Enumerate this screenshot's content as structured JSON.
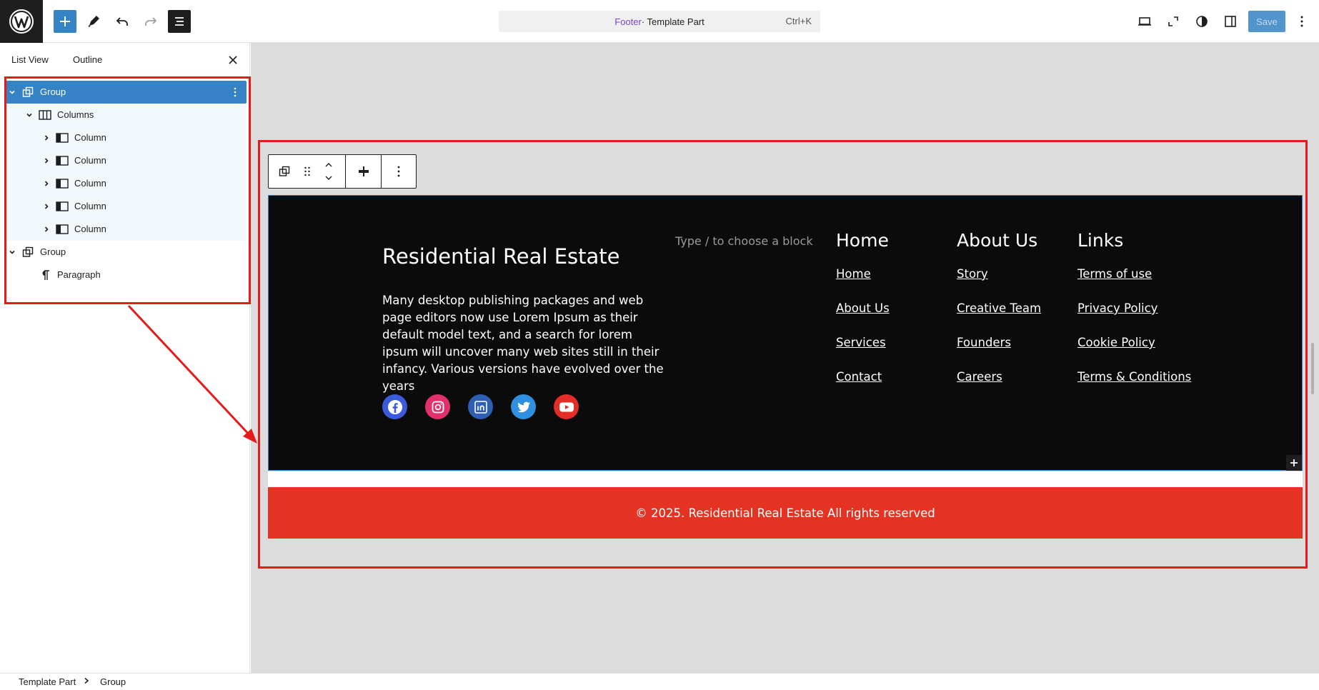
{
  "topbar": {
    "doc_type": "Footer",
    "doc_kind": " · Template Part",
    "shortcut": "Ctrl+K",
    "save_label": "Save"
  },
  "left_panel": {
    "tabs": [
      "List View",
      "Outline"
    ],
    "tree": [
      {
        "label": "Group",
        "icon": "group-icon",
        "depth": 0,
        "expanded": true,
        "selected": true
      },
      {
        "label": "Columns",
        "icon": "columns-icon",
        "depth": 1,
        "expanded": true
      },
      {
        "label": "Column",
        "icon": "column-icon",
        "depth": 2,
        "expanded": false
      },
      {
        "label": "Column",
        "icon": "column-icon",
        "depth": 2,
        "expanded": false
      },
      {
        "label": "Column",
        "icon": "column-icon",
        "depth": 2,
        "expanded": false
      },
      {
        "label": "Column",
        "icon": "column-icon",
        "depth": 2,
        "expanded": false
      },
      {
        "label": "Column",
        "icon": "column-icon",
        "depth": 2,
        "expanded": false
      },
      {
        "label": "Group",
        "icon": "group-icon",
        "depth": 0,
        "expanded": true
      },
      {
        "label": "Paragraph",
        "icon": "paragraph-icon",
        "depth": 1
      }
    ]
  },
  "footer": {
    "brand_title": "Residential Real Estate",
    "brand_desc": "Many desktop publishing packages and web page editors now use Lorem Ipsum as their default model text, and a search for lorem ipsum will uncover many web sites still in their infancy. Various versions have evolved over the years",
    "placeholder": "Type / to choose a block",
    "columns": [
      {
        "heading": "Home",
        "links": [
          "Home",
          "About Us",
          "Services",
          "Contact"
        ]
      },
      {
        "heading": "About Us",
        "links": [
          "Story",
          "Creative Team",
          "Founders",
          "Careers"
        ]
      },
      {
        "heading": "Links",
        "links": [
          "Terms of use",
          "Privacy Policy",
          "Cookie Policy",
          "Terms & Conditions"
        ]
      }
    ],
    "social": [
      "facebook-icon",
      "instagram-icon",
      "linkedin-icon",
      "twitter-icon",
      "youtube-icon"
    ],
    "copyright": "© 2025. Residential Real Estate All rights reserved"
  },
  "breadcrumb": [
    "Template Part",
    "Group"
  ],
  "colors": {
    "accent": "#3582c4",
    "footer_dark": "#0b0b0b",
    "footer_red": "#e53323",
    "annotation": "#e31b1b"
  }
}
